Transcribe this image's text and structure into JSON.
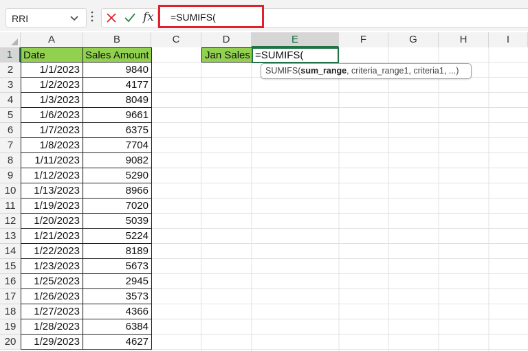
{
  "name_box": {
    "value": "RRI",
    "dropdown_icon": "chevron-down-icon"
  },
  "formula_bar": {
    "cancel_icon": "x-icon",
    "enter_icon": "check-icon",
    "function_icon": "fx-icon",
    "fx_label": "fx",
    "formula": "=SUMIFS(",
    "highlight_color": "#e0202a"
  },
  "columns": [
    "A",
    "B",
    "C",
    "D",
    "E",
    "F",
    "G",
    "H",
    "I"
  ],
  "rows": [
    "1",
    "2",
    "3",
    "4",
    "5",
    "6",
    "7",
    "8",
    "9",
    "10",
    "11",
    "12",
    "13",
    "14",
    "15",
    "16",
    "17",
    "18",
    "19",
    "20"
  ],
  "sheet": {
    "header_date": "Date",
    "header_amount": "Sales Amount",
    "header_fill": "#92d050",
    "records": [
      {
        "date": "1/1/2023",
        "amount": "9840"
      },
      {
        "date": "1/2/2023",
        "amount": "4177"
      },
      {
        "date": "1/3/2023",
        "amount": "8049"
      },
      {
        "date": "1/6/2023",
        "amount": "9661"
      },
      {
        "date": "1/7/2023",
        "amount": "6375"
      },
      {
        "date": "1/8/2023",
        "amount": "7704"
      },
      {
        "date": "1/11/2023",
        "amount": "9082"
      },
      {
        "date": "1/12/2023",
        "amount": "5290"
      },
      {
        "date": "1/13/2023",
        "amount": "8966"
      },
      {
        "date": "1/19/2023",
        "amount": "7020"
      },
      {
        "date": "1/20/2023",
        "amount": "5039"
      },
      {
        "date": "1/21/2023",
        "amount": "5224"
      },
      {
        "date": "1/22/2023",
        "amount": "8189"
      },
      {
        "date": "1/23/2023",
        "amount": "5673"
      },
      {
        "date": "1/25/2023",
        "amount": "2945"
      },
      {
        "date": "1/26/2023",
        "amount": "3573"
      },
      {
        "date": "1/27/2023",
        "amount": "4366"
      },
      {
        "date": "1/28/2023",
        "amount": "6384"
      },
      {
        "date": "1/29/2023",
        "amount": "4627"
      }
    ],
    "label_jan_sales": "Jan Sales",
    "active_cell_formula": "=SUMIFS(",
    "active_column": "E",
    "active_row": "1"
  },
  "tooltip": {
    "prefix": "SUMIFS(",
    "bold_arg": "sum_range",
    "rest": ", criteria_range1, criteria1, ...)"
  }
}
